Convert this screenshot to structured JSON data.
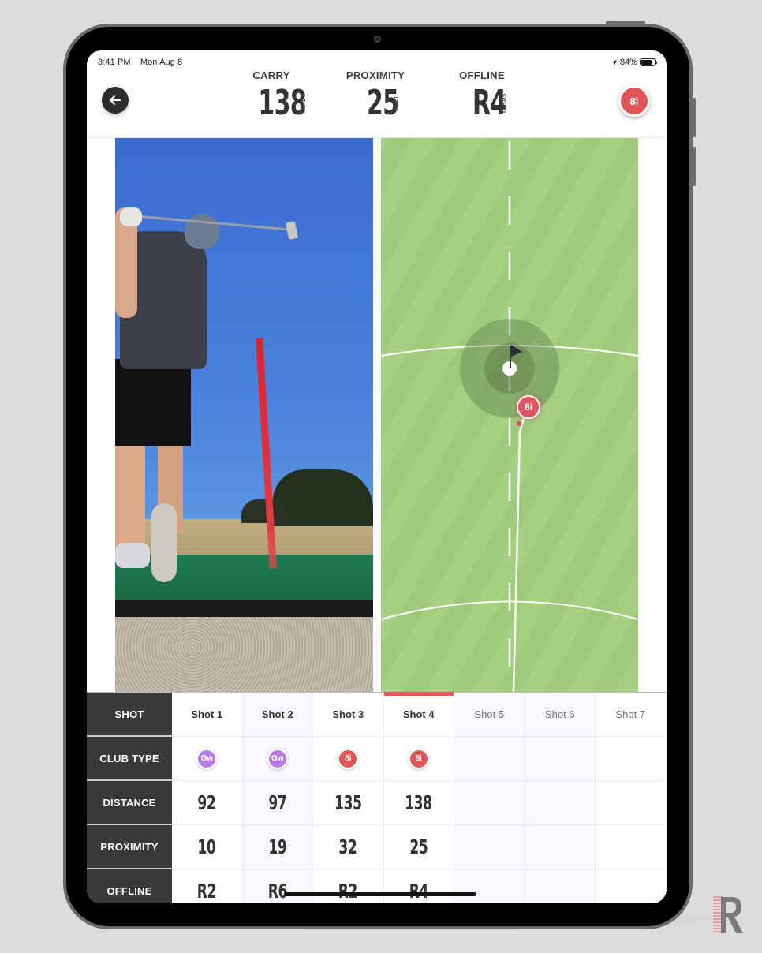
{
  "status_bar": {
    "time": "3:41 PM",
    "date": "Mon Aug 8",
    "location_icon": "location-arrow-icon",
    "battery_percent": "84%",
    "battery_level": 0.84
  },
  "header": {
    "back_icon": "arrow-left-icon",
    "stats": [
      {
        "label": "CARRY",
        "value": "138",
        "unit": "YARDS"
      },
      {
        "label": "PROXIMITY",
        "value": "25",
        "unit": "FEET"
      },
      {
        "label": "OFFLINE",
        "value": "R4",
        "unit": "YARDS"
      }
    ],
    "club_badge": "8i",
    "club_badge_color": "#e05555"
  },
  "map": {
    "shot_badge": "8i",
    "flag_icon": "flag-icon"
  },
  "table": {
    "row_headers": [
      "SHOT",
      "CLUB TYPE",
      "DISTANCE",
      "PROXIMITY",
      "OFFLINE"
    ],
    "active_shot_index": 3,
    "shots": [
      {
        "label": "Shot 1",
        "club": "Gw",
        "club_color": "#b67be8",
        "distance": "92",
        "proximity": "10",
        "offline": "R2"
      },
      {
        "label": "Shot 2",
        "club": "Gw",
        "club_color": "#b67be8",
        "distance": "97",
        "proximity": "19",
        "offline": "R6"
      },
      {
        "label": "Shot 3",
        "club": "8i",
        "club_color": "#e05555",
        "distance": "135",
        "proximity": "32",
        "offline": "R2"
      },
      {
        "label": "Shot 4",
        "club": "8i",
        "club_color": "#e05555",
        "distance": "138",
        "proximity": "25",
        "offline": "R4"
      },
      {
        "label": "Shot 5",
        "club": "",
        "club_color": "",
        "distance": "",
        "proximity": "",
        "offline": ""
      },
      {
        "label": "Shot 6",
        "club": "",
        "club_color": "",
        "distance": "",
        "proximity": "",
        "offline": ""
      },
      {
        "label": "Shot 7",
        "club": "",
        "club_color": "",
        "distance": "",
        "proximity": "",
        "offline": ""
      }
    ]
  },
  "colors": {
    "accent_red": "#e05a5a",
    "header_dark": "#3a3839",
    "fairway_green": "#a6cf82",
    "gap_wedge_purple": "#b67be8"
  },
  "watermark": {
    "logo": "rapsodo-r-logo-icon"
  }
}
